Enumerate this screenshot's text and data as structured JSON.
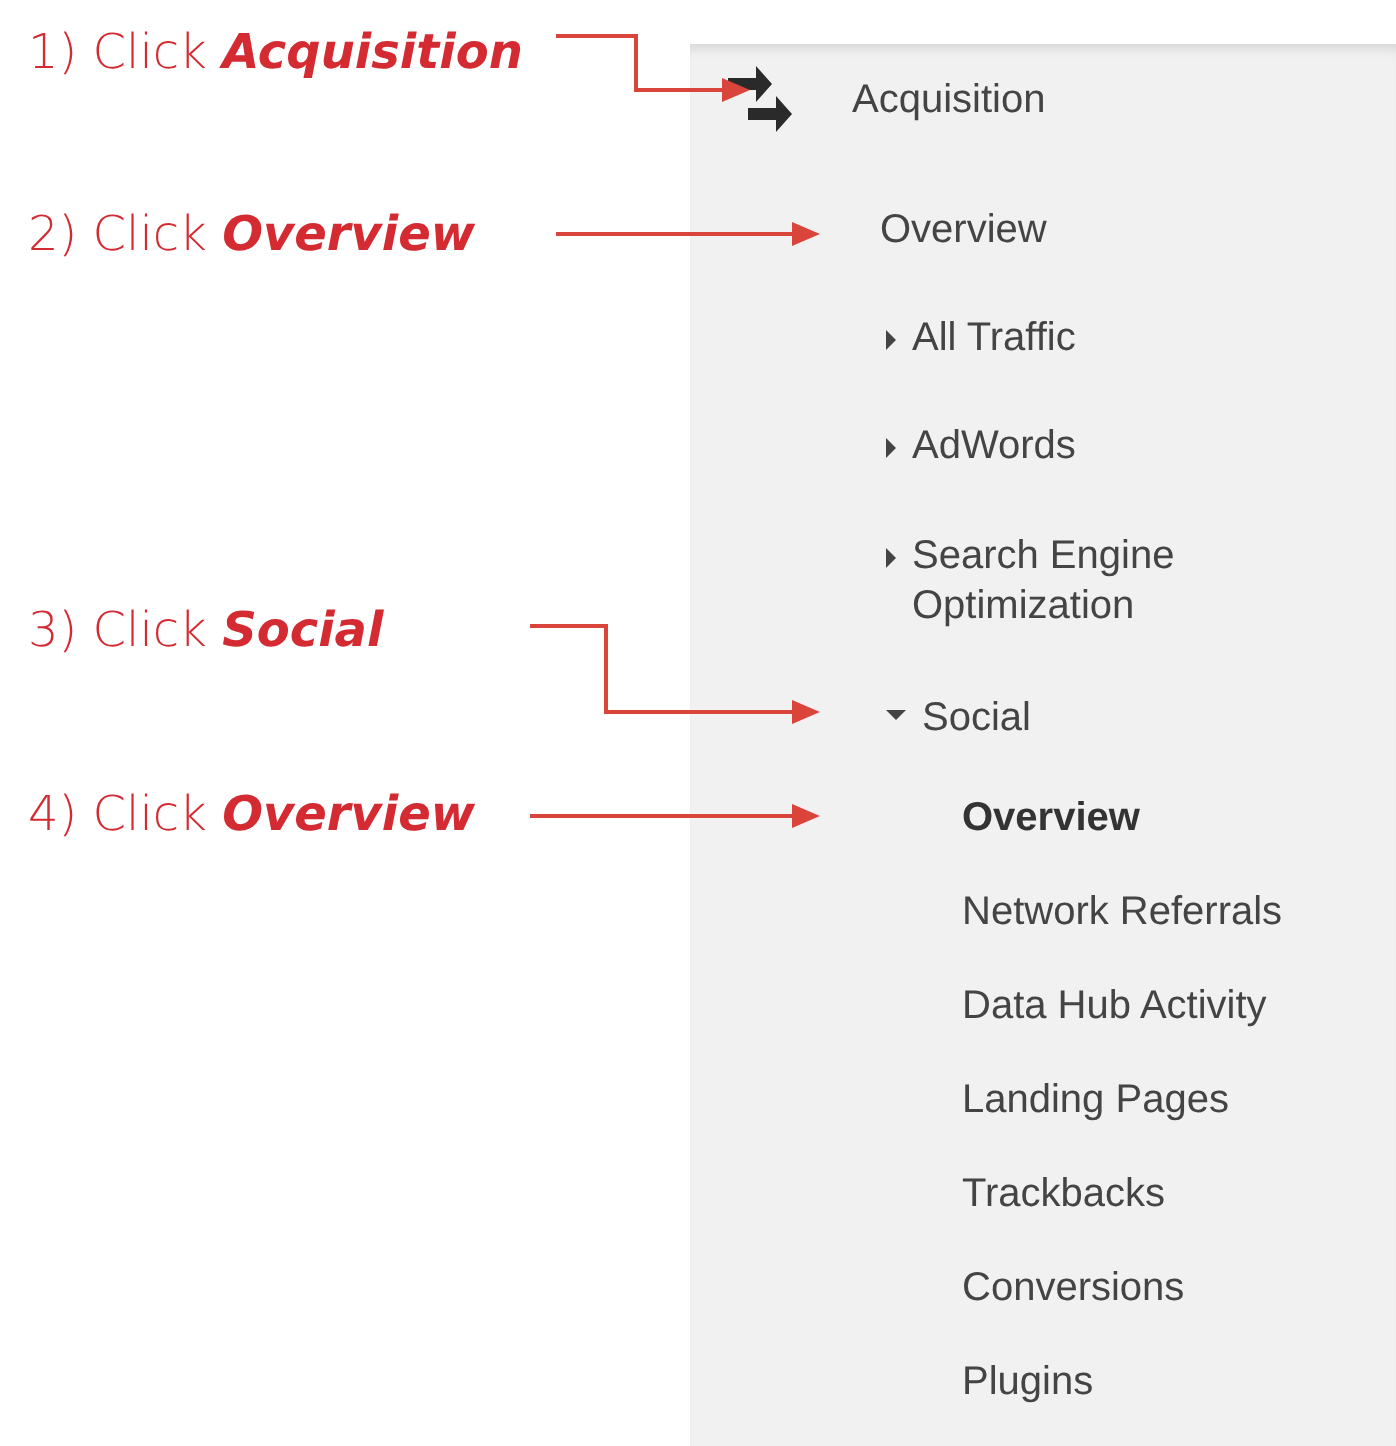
{
  "annotations": [
    {
      "prefix": "1) Click",
      "target": "Acquisition"
    },
    {
      "prefix": "2) Click",
      "target": "Overview"
    },
    {
      "prefix": "3) Click",
      "target": "Social"
    },
    {
      "prefix": "4) Click",
      "target": "Overview"
    }
  ],
  "sidebar": {
    "section": {
      "label": "Acquisition",
      "items": [
        {
          "label": "Overview"
        },
        {
          "label": "All Traffic",
          "expanded": false
        },
        {
          "label": "AdWords",
          "expanded": false
        },
        {
          "label": "Search Engine Optimization",
          "expanded": false
        },
        {
          "label": "Social",
          "expanded": true,
          "children": [
            {
              "label": "Overview",
              "selected": true
            },
            {
              "label": "Network Referrals",
              "selected": false
            },
            {
              "label": "Data Hub Activity",
              "selected": false
            },
            {
              "label": "Landing Pages",
              "selected": false
            },
            {
              "label": "Trackbacks",
              "selected": false
            },
            {
              "label": "Conversions",
              "selected": false
            },
            {
              "label": "Plugins",
              "selected": false
            }
          ]
        }
      ]
    }
  }
}
